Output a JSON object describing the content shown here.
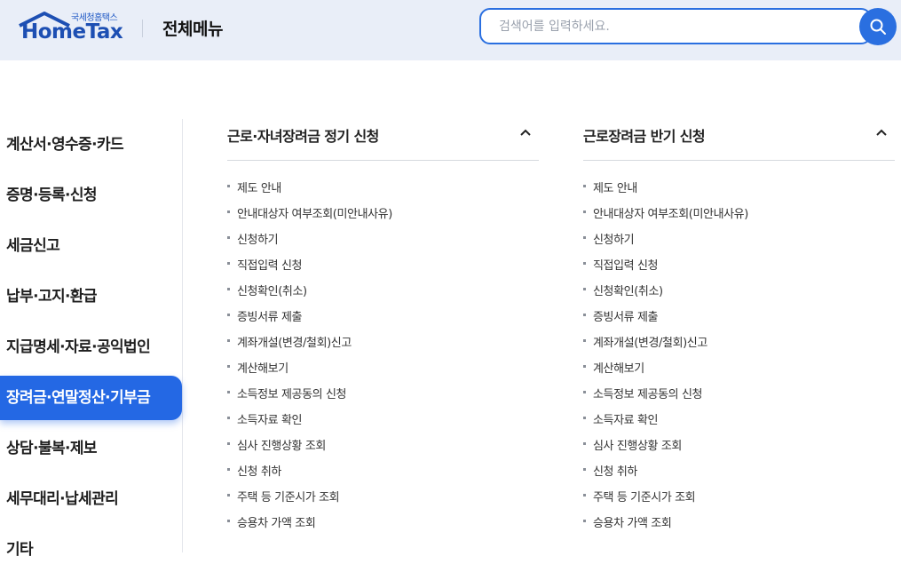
{
  "header": {
    "logo_sub": "국세청홈택스",
    "logo_main": "HomeTax",
    "title": "전체메뉴",
    "search_placeholder": "검색어를 입력하세요.",
    "search_icon": "search-icon"
  },
  "sidebar": {
    "items": [
      {
        "label": "계산서·영수증·카드"
      },
      {
        "label": "증명·등록·신청"
      },
      {
        "label": "세금신고"
      },
      {
        "label": "납부·고지·환급"
      },
      {
        "label": "지급명세·자료·공익법인"
      },
      {
        "label": "장려금·연말정산·기부금",
        "active": true
      },
      {
        "label": "상담·불복·제보"
      },
      {
        "label": "세무대리·납세관리"
      },
      {
        "label": "기타"
      }
    ],
    "active_color": "#2468e4"
  },
  "sections": [
    {
      "title": "근로·자녀장려금 정기 신청",
      "toggle_icon": "chevron-up-icon",
      "links": [
        "제도 안내",
        "안내대상자 여부조회(미안내사유)",
        "신청하기",
        "직접입력 신청",
        "신청확인(취소)",
        "증빙서류 제출",
        "계좌개설(변경/철회)신고",
        "계산해보기",
        "소득정보 제공동의 신청",
        "소득자료 확인",
        "심사 진행상황 조회",
        "신청 취하",
        "주택 등 기준시가 조회",
        "승용차 가액 조회"
      ]
    },
    {
      "title": "근로장려금 반기 신청",
      "toggle_icon": "chevron-up-icon",
      "links": [
        "제도 안내",
        "안내대상자 여부조회(미안내사유)",
        "신청하기",
        "직접입력 신청",
        "신청확인(취소)",
        "증빙서류 제출",
        "계좌개설(변경/철회)신고",
        "계산해보기",
        "소득정보 제공동의 신청",
        "소득자료 확인",
        "심사 진행상황 조회",
        "신청 취하",
        "주택 등 기준시가 조회",
        "승용차 가액 조회"
      ]
    }
  ]
}
